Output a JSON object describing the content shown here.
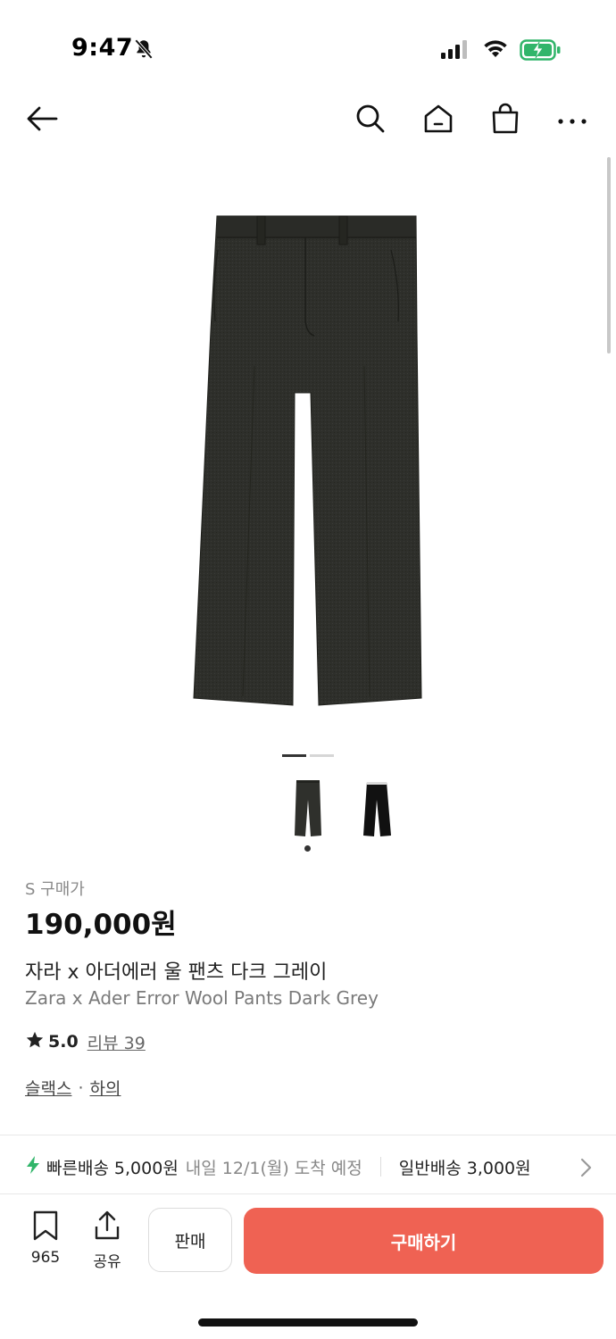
{
  "status_bar": {
    "time": "9:47"
  },
  "nav": {
    "back_icon": "arrow-left-icon",
    "search_icon": "search-icon",
    "home_icon": "home-icon",
    "cart_icon": "shopping-bag-icon",
    "more_icon": "more-horizontal-icon"
  },
  "product": {
    "size_label": "S 구매가",
    "price": "190,000원",
    "name_ko": "자라 x 아더에러 울 팬츠 다크 그레이",
    "name_en": "Zara x Ader Error Wool Pants Dark Grey",
    "rating": "5.0",
    "review_label": "리뷰 39",
    "categories": [
      "슬랙스",
      "하의"
    ],
    "category_separator": "·"
  },
  "delivery": {
    "fast_label": "빠른배송",
    "fast_fee": "5,000원",
    "fast_eta": "내일 12/1(월) 도착 예정",
    "normal_label": "일반배송 3,000원"
  },
  "bottom_bar": {
    "bookmark_count": "965",
    "share_label": "공유",
    "sell_label": "판매",
    "buy_label": "구매하기"
  },
  "colors": {
    "buy_button": "#ef6253",
    "fast_delivery_icon": "#31b56a"
  }
}
